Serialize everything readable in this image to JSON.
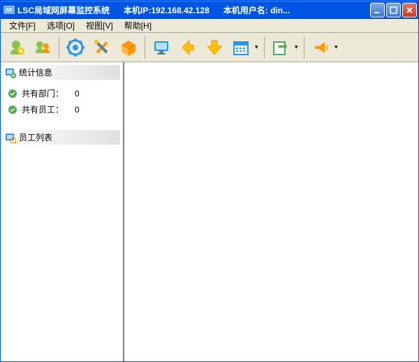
{
  "title": {
    "app": "LSC局域网屏幕监控系统",
    "ip_label": "本机IP:",
    "ip": "192.168.42.128",
    "user_label": "本机用户名:",
    "user": "din..."
  },
  "menu": {
    "file": "文件[F]",
    "options": "选项[O]",
    "view": "视图[V]",
    "help": "帮助[H]"
  },
  "toolbar": {
    "icons": [
      "user-add",
      "user-pair",
      "settings-gear",
      "tools",
      "package",
      "monitor",
      "arrow-left",
      "arrow-down",
      "calendar",
      "export",
      "announce"
    ]
  },
  "sidebar": {
    "stats_header": "统计信息",
    "dept_label": "共有部门：",
    "dept_count": "0",
    "emp_label": "共有员工：",
    "emp_count": "0",
    "list_header": "员工列表"
  }
}
